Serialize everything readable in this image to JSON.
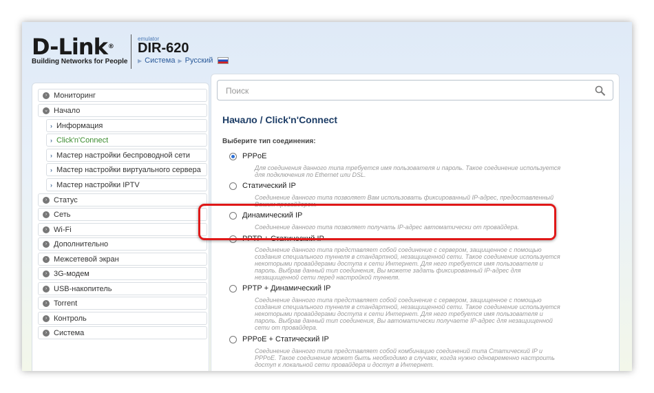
{
  "header": {
    "logo": "D-Link",
    "tagline": "Building Networks for People",
    "emulator": "emulator",
    "model": "DIR-620",
    "links": [
      "Система",
      "Русский"
    ]
  },
  "sidebar": {
    "items": [
      {
        "label": "Мониторинг"
      },
      {
        "label": "Начало"
      },
      {
        "label": "Информация"
      },
      {
        "label": "Click'n'Connect"
      },
      {
        "label": "Мастер настройки беспроводной сети"
      },
      {
        "label": "Мастер настройки виртуального сервера"
      },
      {
        "label": "Мастер настройки IPTV"
      },
      {
        "label": "Статус"
      },
      {
        "label": "Сеть"
      },
      {
        "label": "Wi-Fi"
      },
      {
        "label": "Дополнительно"
      },
      {
        "label": "Межсетевой экран"
      },
      {
        "label": "3G-модем"
      },
      {
        "label": "USB-накопитель"
      },
      {
        "label": "Torrent"
      },
      {
        "label": "Контроль"
      },
      {
        "label": "Система"
      }
    ]
  },
  "search": {
    "placeholder": "Поиск"
  },
  "main": {
    "breadcrumb": "Начало /  Click'n'Connect",
    "subtitle": "Выберите тип соединения:",
    "options": [
      {
        "label": "PPPoE",
        "desc": "Для соединения данного типа требуется имя пользователя и пароль. Такое соединение используется для подключения по Ethernet или DSL."
      },
      {
        "label": "Статический IP",
        "desc": "Соединение данного типа позволяет Вам использовать фиксированный IP-адрес, предоставленный Вашим провайдером."
      },
      {
        "label": "Динамический IP",
        "desc": "Соединение данного типа позволяет получать IP-адрес автоматически от провайдера."
      },
      {
        "label": "PPTP + Статический IP",
        "desc": "Соединение данного типа представляет собой соединение с сервером, защищенное с помощью создания специального туннеля в стандартной, незащищенной сети. Такое соединение используется некоторыми провайдерами доступа к сети Интернет. Для него требуется имя пользователя и пароль. Выбрав данный тип соединения, Вы можете задать фиксированный IP-адрес для незащищенной сети перед настройкой туннеля."
      },
      {
        "label": "PPTP + Динамический IP",
        "desc": "Соединение данного типа представляет собой соединение с сервером, защищенное с помощью создания специального туннеля в стандартной, незащищенной сети. Такое соединение используется некоторыми провайдерами доступа к сети Интернет. Для него требуется имя пользователя и пароль. Выбрав данный тип соединения, Вы автоматически получаете IP-адрес для незащищенной сети от провайдера."
      },
      {
        "label": "PPPoE + Статический IP",
        "desc": "Соединение данного типа представляет собой комбинацию соединений типа Статический IP и PPPoE. Такое соединение может быть необходимо в случаях, когда нужно одновременно настроить доступ к локальной сети провайдера и доступ в Интернет."
      }
    ],
    "selected": "PPPoE"
  },
  "colors": {
    "accent": "#1d3d66",
    "active_nav": "#3a8b2d",
    "highlight": "#e01818"
  }
}
